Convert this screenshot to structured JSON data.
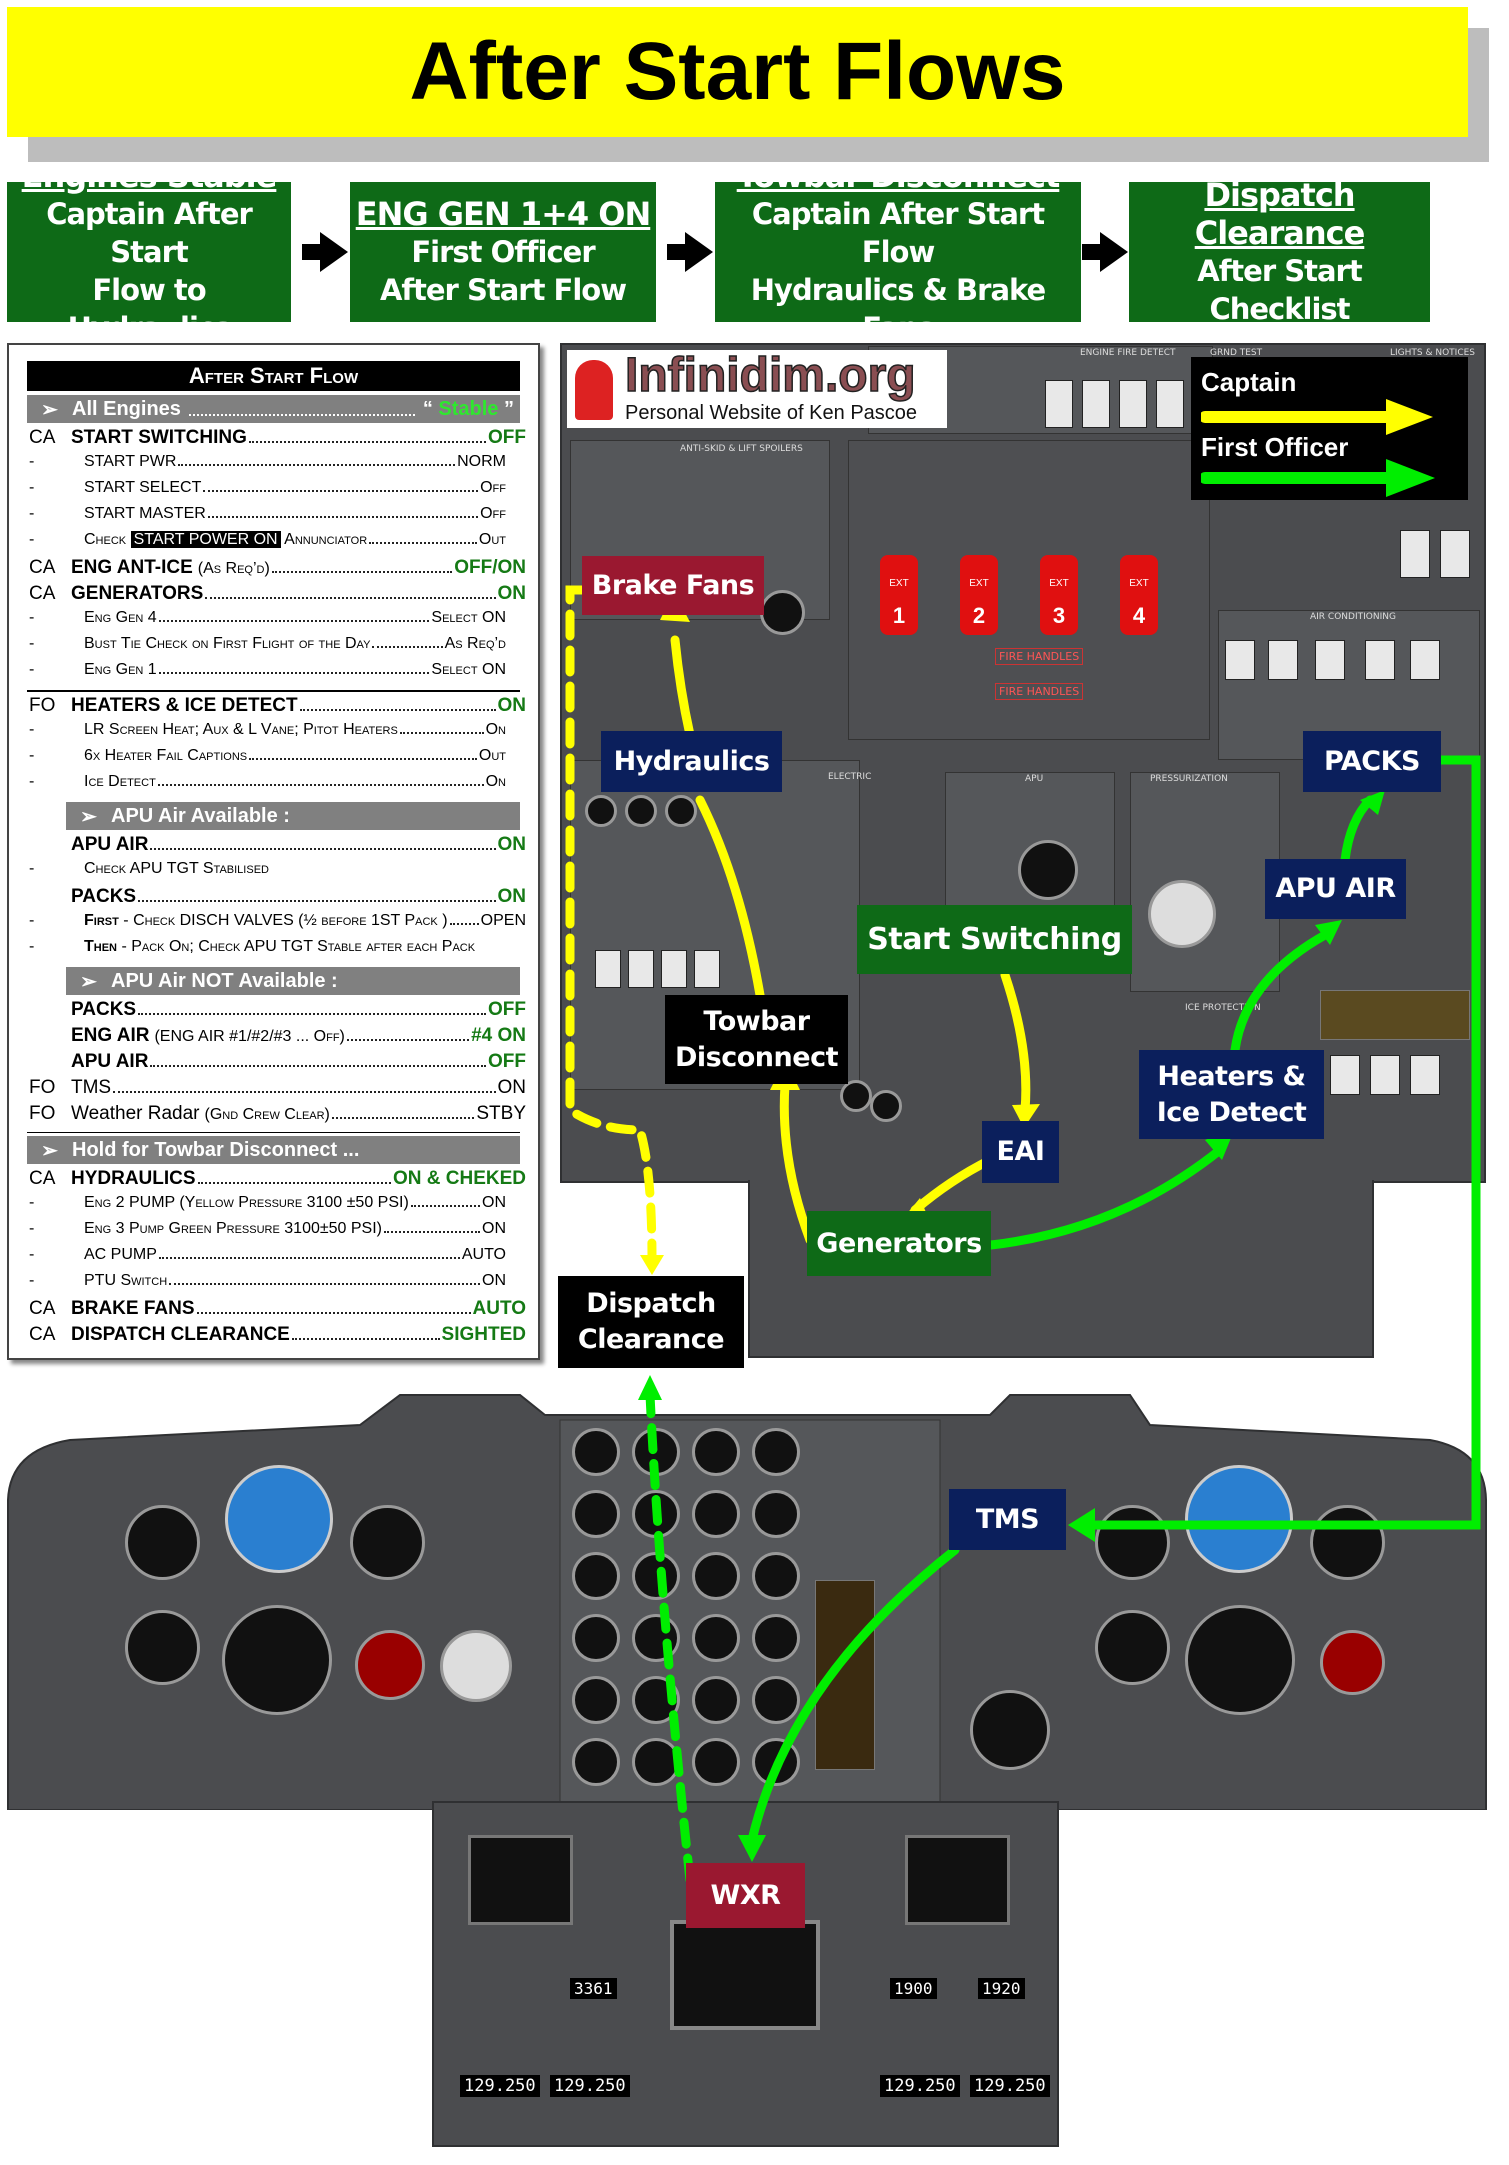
{
  "title": "After Start Flows",
  "flow_steps": [
    {
      "heading": "Engines Stable",
      "line1": "Captain After Start",
      "line2": "Flow to Hydraulics"
    },
    {
      "heading": "ENG GEN 1+4 ON",
      "line1": "First Officer",
      "line2": "After Start Flow"
    },
    {
      "heading": "Towbar Disconnect",
      "line1": "Captain After Start Flow",
      "line2": "Hydraulics & Brake Fans"
    },
    {
      "heading": "Dispatch Clearance",
      "line1": "After Start Checklist",
      "line2": ""
    }
  ],
  "checklist": {
    "title": "After Start Flow",
    "all_engines": {
      "label": "All Engines",
      "value_open": "“ ",
      "value": "Stable",
      "value_close": " ”"
    },
    "start_switching": {
      "role": "CA",
      "label": "START SWITCHING",
      "value": "OFF",
      "subs": [
        {
          "label": "START PWR",
          "value": "NORM"
        },
        {
          "label": "START SELECT",
          "value": "Off"
        },
        {
          "label": "START MASTER",
          "value": "Off"
        }
      ],
      "check": {
        "prefix": "Check",
        "highlight": "START POWER ON",
        "suffix": "Annunciator",
        "value": "Out"
      }
    },
    "eng_anti_ice": {
      "role": "CA",
      "label": "ENG ANT-ICE",
      "note": "(As Req’d)",
      "value": "OFF/ON"
    },
    "generators": {
      "role": "CA",
      "label": "GENERATORS",
      "value": "ON",
      "subs": [
        {
          "label": "Eng Gen 4",
          "value": "Select ON"
        },
        {
          "label": "Bust Tie Check on First Flight of the Day",
          "value": "As Req’d"
        },
        {
          "label": "Eng Gen 1",
          "value": "Select ON"
        }
      ]
    },
    "heaters": {
      "role": "FO",
      "label": "HEATERS & ICE DETECT",
      "value": "ON",
      "subs": [
        {
          "label": "LR Screen Heat; Aux & L Vane; Pitot Heaters",
          "value": "On"
        },
        {
          "label": "6x Heater Fail Captions",
          "value": "Out"
        },
        {
          "label": "Ice Detect",
          "value": "On"
        }
      ]
    },
    "apu_available": {
      "label": "APU Air Available :",
      "apu_air": {
        "label": "APU AIR",
        "value": "ON"
      },
      "apu_check": "Check APU TGT Stabilised",
      "packs": {
        "label": "PACKS",
        "value": "ON"
      },
      "packs_first": {
        "bold": "First",
        "label": "- Check DISCH VALVES (½ before 1ST Pack )",
        "value": "OPEN"
      },
      "packs_then": {
        "bold": "Then",
        "label": "- Pack On; Check APU TGT Stable after each Pack"
      }
    },
    "apu_not_available": {
      "label": "APU Air NOT Available :",
      "packs": {
        "label": "PACKS",
        "value": "OFF"
      },
      "eng_air": {
        "label": "ENG AIR",
        "note": "(ENG AIR #1/#2/#3 ... Off)",
        "value": "#4 ON"
      },
      "apu_air": {
        "label": "APU AIR",
        "value": "OFF"
      }
    },
    "tms": {
      "role": "FO",
      "label": "TMS",
      "value": "ON"
    },
    "wxr": {
      "role": "FO",
      "label": "Weather Radar",
      "note": "(Gnd Crew Clear)",
      "value": "STBY"
    },
    "hold": {
      "label": "Hold for Towbar Disconnect ..."
    },
    "hydraulics": {
      "role": "CA",
      "label": "HYDRAULICS",
      "value": "ON & CHEKED",
      "subs": [
        {
          "label": "Eng 2 PUMP (Yellow Pressure 3100 ±50 PSI)",
          "value": "ON"
        },
        {
          "label": "Eng 3 Pump Green Pressure 3100±50 PSI)",
          "value": "ON"
        },
        {
          "label": "AC PUMP",
          "value": "AUTO"
        },
        {
          "label": "PTU Switch",
          "value": "ON"
        }
      ]
    },
    "brake_fans": {
      "role": "CA",
      "label": "BRAKE FANS",
      "value": "AUTO"
    },
    "dispatch": {
      "role": "CA",
      "label": "DISPATCH CLEARANCE",
      "value": "SIGHTED"
    }
  },
  "logo": {
    "name": "Infinidim.org",
    "tagline": "Personal Website of Ken Pascoe"
  },
  "legend": {
    "captain": "Captain",
    "first_officer": "First Officer",
    "captain_color": "#ffff00",
    "first_officer_color": "#00ee00"
  },
  "callouts": {
    "brake_fans": "Brake Fans",
    "hydraulics": "Hydraulics",
    "packs": "PACKS",
    "apu_air": "APU AIR",
    "start_switching": "Start Switching",
    "towbar_l1": "Towbar",
    "towbar_l2": "Disconnect",
    "eai": "EAI",
    "heaters_l1": "Heaters &",
    "heaters_l2": "Ice Detect",
    "generators": "Generators",
    "dispatch_l1": "Dispatch",
    "dispatch_l2": "Clearance",
    "tms": "TMS",
    "wxr": "WXR"
  },
  "panel_labels": {
    "engine_fire_detect": "ENGINE FIRE DETECT",
    "anti_skid": "ANTI-SKID & LIFT SPOILERS",
    "air_conditioning": "AIR CONDITIONING",
    "fire_handles": "FIRE HANDLES",
    "grnd_test": "GRND TEST",
    "lights_notices": "LIGHTS & NOTICES",
    "pressurization": "PRESSURIZATION",
    "ice_protection": "ICE PROTECTION",
    "electric": "ELECTRIC",
    "apu": "APU",
    "fire_handle_numbers": [
      "1",
      "2",
      "3",
      "4"
    ],
    "fire_handle_ext": "EXT"
  },
  "pedestal": {
    "left_freq_1": "129.250",
    "left_freq_2": "129.250",
    "right_freq_1": "129.250",
    "right_freq_2": "129.250",
    "atc": "3361",
    "adf_left": "1900",
    "adf_right": "1920"
  }
}
